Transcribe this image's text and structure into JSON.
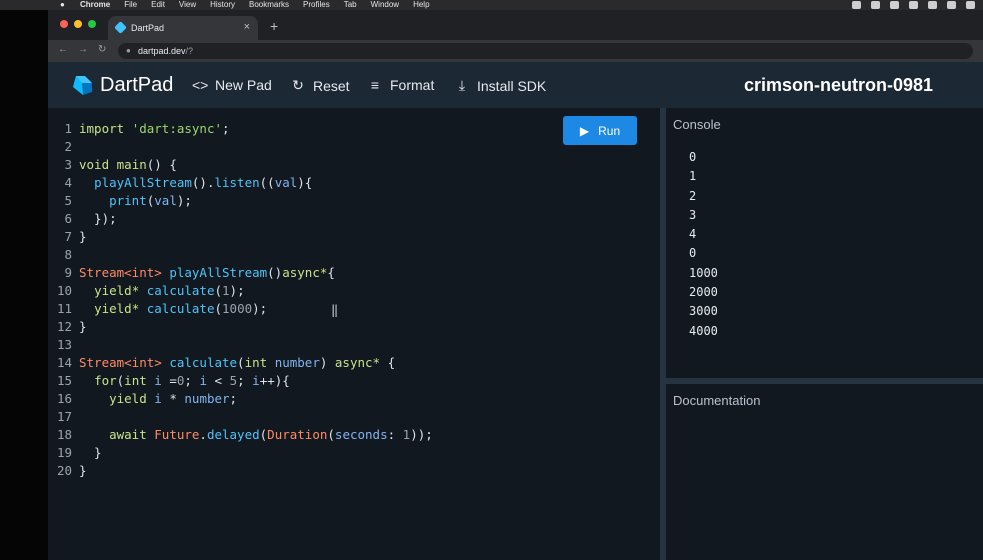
{
  "menubar": {
    "app": "Chrome",
    "items": [
      "File",
      "Edit",
      "View",
      "History",
      "Bookmarks",
      "Profiles",
      "Tab",
      "Window",
      "Help"
    ]
  },
  "browser": {
    "tab_title": "DartPad",
    "url_host": "dartpad.dev",
    "url_path": "/?"
  },
  "header": {
    "brand": "DartPad",
    "new_pad": "New Pad",
    "reset": "Reset",
    "format": "Format",
    "install_sdk": "Install SDK",
    "pad_name": "crimson-neutron-0981"
  },
  "editor": {
    "run_label": "Run",
    "line_numbers": [
      "1",
      "2",
      "3",
      "4",
      "5",
      "6",
      "7",
      "8",
      "9",
      "10",
      "11",
      "12",
      "13",
      "14",
      "15",
      "16",
      "17",
      "18",
      "19",
      "20"
    ],
    "lines": [
      [
        {
          "t": "import ",
          "c": "kw"
        },
        {
          "t": "'dart:async'",
          "c": "str"
        },
        {
          "t": ";",
          "c": "src"
        }
      ],
      [],
      [
        {
          "t": "void ",
          "c": "kw"
        },
        {
          "t": "main",
          "c": "kw"
        },
        {
          "t": "() {",
          "c": "src"
        }
      ],
      [
        {
          "t": "  ",
          "c": "src"
        },
        {
          "t": "playAllStream",
          "c": "fn"
        },
        {
          "t": "().",
          "c": "src"
        },
        {
          "t": "listen",
          "c": "fn"
        },
        {
          "t": "((",
          "c": "src"
        },
        {
          "t": "val",
          "c": "var"
        },
        {
          "t": "){",
          "c": "src"
        }
      ],
      [
        {
          "t": "    ",
          "c": "src"
        },
        {
          "t": "print",
          "c": "fn"
        },
        {
          "t": "(",
          "c": "src"
        },
        {
          "t": "val",
          "c": "var"
        },
        {
          "t": ");",
          "c": "src"
        }
      ],
      [
        {
          "t": "  });",
          "c": "src"
        }
      ],
      [
        {
          "t": "}",
          "c": "src"
        }
      ],
      [],
      [
        {
          "t": "Stream<int> ",
          "c": "ty"
        },
        {
          "t": "playAllStream",
          "c": "fn"
        },
        {
          "t": "()",
          "c": "src"
        },
        {
          "t": "async*",
          "c": "kw"
        },
        {
          "t": "{",
          "c": "src"
        }
      ],
      [
        {
          "t": "  ",
          "c": "src"
        },
        {
          "t": "yield*",
          "c": "kw"
        },
        {
          "t": " ",
          "c": "src"
        },
        {
          "t": "calculate",
          "c": "fn"
        },
        {
          "t": "(",
          "c": "src"
        },
        {
          "t": "1",
          "c": "num"
        },
        {
          "t": ");",
          "c": "src"
        }
      ],
      [
        {
          "t": "  ",
          "c": "src"
        },
        {
          "t": "yield*",
          "c": "kw"
        },
        {
          "t": " ",
          "c": "src"
        },
        {
          "t": "calculate",
          "c": "fn"
        },
        {
          "t": "(",
          "c": "src"
        },
        {
          "t": "1000",
          "c": "num"
        },
        {
          "t": ");",
          "c": "src"
        }
      ],
      [
        {
          "t": "}",
          "c": "src"
        }
      ],
      [],
      [
        {
          "t": "Stream<int> ",
          "c": "ty"
        },
        {
          "t": "calculate",
          "c": "fn"
        },
        {
          "t": "(",
          "c": "src"
        },
        {
          "t": "int ",
          "c": "kw"
        },
        {
          "t": "number",
          "c": "var"
        },
        {
          "t": ") ",
          "c": "src"
        },
        {
          "t": "async*",
          "c": "kw"
        },
        {
          "t": " {",
          "c": "src"
        }
      ],
      [
        {
          "t": "  ",
          "c": "src"
        },
        {
          "t": "for",
          "c": "kw"
        },
        {
          "t": "(",
          "c": "src"
        },
        {
          "t": "int ",
          "c": "kw"
        },
        {
          "t": "i",
          "c": "var"
        },
        {
          "t": " =",
          "c": "src"
        },
        {
          "t": "0",
          "c": "num"
        },
        {
          "t": "; ",
          "c": "src"
        },
        {
          "t": "i",
          "c": "var"
        },
        {
          "t": " < ",
          "c": "src"
        },
        {
          "t": "5",
          "c": "num"
        },
        {
          "t": "; ",
          "c": "src"
        },
        {
          "t": "i",
          "c": "var"
        },
        {
          "t": "++){",
          "c": "src"
        }
      ],
      [
        {
          "t": "    ",
          "c": "src"
        },
        {
          "t": "yield",
          "c": "kw"
        },
        {
          "t": " ",
          "c": "src"
        },
        {
          "t": "i",
          "c": "var"
        },
        {
          "t": " * ",
          "c": "src"
        },
        {
          "t": "number",
          "c": "var"
        },
        {
          "t": ";",
          "c": "src"
        }
      ],
      [],
      [
        {
          "t": "    ",
          "c": "src"
        },
        {
          "t": "await ",
          "c": "kw"
        },
        {
          "t": "Future",
          "c": "ty"
        },
        {
          "t": ".",
          "c": "src"
        },
        {
          "t": "delayed",
          "c": "fn"
        },
        {
          "t": "(",
          "c": "src"
        },
        {
          "t": "Duration",
          "c": "ty"
        },
        {
          "t": "(",
          "c": "src"
        },
        {
          "t": "seconds",
          "c": "var"
        },
        {
          "t": ": ",
          "c": "src"
        },
        {
          "t": "1",
          "c": "num"
        },
        {
          "t": "));",
          "c": "src"
        }
      ],
      [
        {
          "t": "  }",
          "c": "src"
        }
      ],
      [
        {
          "t": "}",
          "c": "src"
        }
      ]
    ]
  },
  "console": {
    "title": "Console",
    "output": [
      "0",
      "1",
      "2",
      "3",
      "4",
      "0",
      "1000",
      "2000",
      "3000",
      "4000"
    ]
  },
  "documentation": {
    "title": "Documentation"
  },
  "colors": {
    "run_button": "#1e88e5",
    "app_background": "#1c2834",
    "editor_background": "#121820"
  }
}
